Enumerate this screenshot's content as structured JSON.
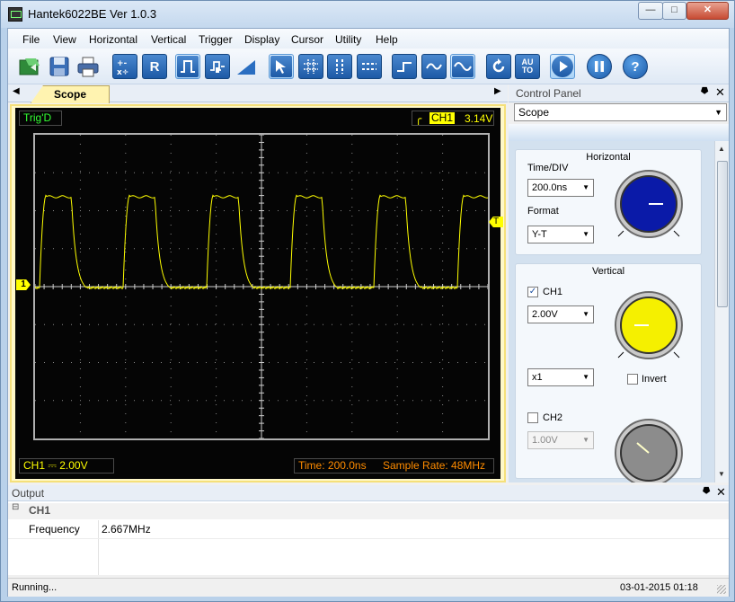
{
  "window": {
    "title": "Hantek6022BE Ver 1.0.3"
  },
  "menu": [
    "File",
    "View",
    "Horizontal",
    "Vertical",
    "Trigger",
    "Display",
    "Cursor",
    "Utility",
    "Help"
  ],
  "toolbar": {
    "icons": [
      "open-icon",
      "save-icon",
      "print-icon",
      "math-icon",
      "reference-icon",
      "pulse-trigger-icon",
      "video-trigger-icon",
      "slope-icon",
      "pointer-icon",
      "grid-icon",
      "vertical-cursor-icon",
      "horizontal-cursor-icon",
      "step-icon",
      "wave-icon",
      "sine-icon",
      "refresh-icon",
      "auto-icon",
      "run-icon",
      "pause-icon",
      "help-icon"
    ],
    "labels": {
      "reference": "R",
      "auto_top": "AU",
      "auto_bottom": "TO",
      "help": "?"
    }
  },
  "scope_tab": {
    "label": "Scope"
  },
  "scope": {
    "trig_status": "Trig'D",
    "trigger_channel": "CH1",
    "trigger_level": "3.14V",
    "trigger_edge_symbol": "┡",
    "channel_marker": "1",
    "trigger_marker": "T",
    "ch1_scale": "CH1 ⎓  2.00V",
    "time_div": "Time: 200.0ns",
    "sample_rate": "Sample Rate: 48MHz",
    "trace_color": "#ffff00",
    "grid_color": "#8a8a8a"
  },
  "control_panel": {
    "title": "Control Panel",
    "selected_view": "Scope",
    "horizontal": {
      "title": "Horizontal",
      "time_div_label": "Time/DIV",
      "time_div_value": "200.0ns",
      "format_label": "Format",
      "format_value": "Y-T",
      "knob_color": "#0a1aa8"
    },
    "vertical": {
      "title": "Vertical",
      "ch1_label": "CH1",
      "ch1_checked": true,
      "ch1_volts": "2.00V",
      "probe": "x1",
      "invert_label": "Invert",
      "ch2_label": "CH2",
      "ch2_checked": false,
      "ch2_volts": "1.00V",
      "ch1_knob_color": "#f5f000",
      "ch2_knob_color": "#8c8c8c"
    }
  },
  "output": {
    "title": "Output",
    "group": "CH1",
    "rows": [
      {
        "key": "Frequency",
        "value": "2.667MHz"
      }
    ]
  },
  "status": {
    "left": "Running...",
    "right": "03-01-2015  01:18"
  }
}
